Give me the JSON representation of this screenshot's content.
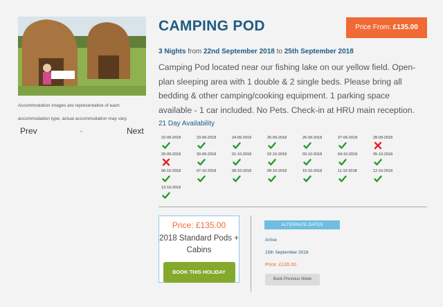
{
  "product": {
    "title": "CAMPING POD",
    "price_badge_prefix": "Price From: ",
    "price_badge_value": "£135.00",
    "nights": "3 Nights",
    "from_word": " from ",
    "start_date": "22nd September 2018",
    "to_word": " to ",
    "end_date": "25th September 2018",
    "description": "Camping Pod located near our fishing lake on our yellow field. Open-plan sleeping area with 1 double & 2 single beds. Please bring all bedding & other camping/cooking equipment. 1 parking space available - 1 car included. No Pets. Check-in at HRU main reception."
  },
  "gallery": {
    "caption": "Accommodation images are representative of each accommodation type, actual accommodation may vary.",
    "prev_label": "Prev",
    "next_label": "Next"
  },
  "availability": {
    "title": "21 Day Availability",
    "available_color": "#1e9e2e",
    "unavailable_color": "#e0242b",
    "days": [
      {
        "date": "22-09-2018",
        "available": true
      },
      {
        "date": "23-09-2018",
        "available": true
      },
      {
        "date": "24-09-2018",
        "available": true
      },
      {
        "date": "25-09-2018",
        "available": true
      },
      {
        "date": "26-09-2018",
        "available": true
      },
      {
        "date": "27-09-2018",
        "available": true
      },
      {
        "date": "28-09-2018",
        "available": false
      },
      {
        "date": "29-09-2018",
        "available": false
      },
      {
        "date": "30-09-2018",
        "available": true
      },
      {
        "date": "01-10-2018",
        "available": true
      },
      {
        "date": "02-10-2018",
        "available": true
      },
      {
        "date": "03-10-2018",
        "available": true
      },
      {
        "date": "04-10-2018",
        "available": true
      },
      {
        "date": "05-10-2018",
        "available": true
      },
      {
        "date": "06-10-2018",
        "available": true
      },
      {
        "date": "07-10-2018",
        "available": true
      },
      {
        "date": "08-10-2018",
        "available": true
      },
      {
        "date": "09-10-2018",
        "available": true
      },
      {
        "date": "10-10-2018",
        "available": true
      },
      {
        "date": "11-10-2018",
        "available": true
      },
      {
        "date": "12-10-2018",
        "available": true
      },
      {
        "date": "13-10-2018",
        "available": true
      }
    ]
  },
  "booking": {
    "price_prefix": "Price: ",
    "price_value": "£135.00",
    "pod_name": "2018 Standard Pods + Cabins",
    "book_label": "BOOK THIS HOLIDAY"
  },
  "alternate": {
    "label": "ALTERNATE DATES",
    "arrive_label": "Arrive",
    "arrive_date": "15th September 2018",
    "price_prefix": "Price: ",
    "price_value": "£135.00",
    "book_previous_label": "Book Previous Week"
  },
  "colors": {
    "brand_blue": "#1f5b85",
    "accent_orange": "#ef6a35",
    "button_green": "#84a92d",
    "light_blue": "#6fbde0"
  }
}
